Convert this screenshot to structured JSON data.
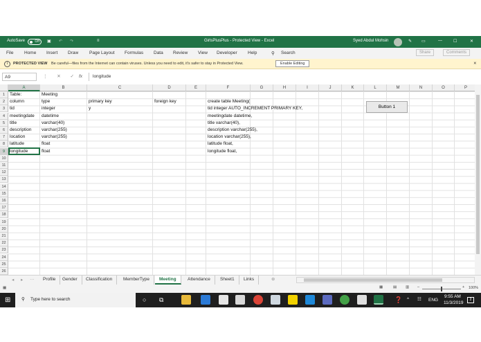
{
  "titlebar": {
    "autosave_label": "AutoSave",
    "autosave_state": "Off",
    "quick_access": [
      "↶",
      "↷",
      "≡"
    ],
    "doc_title": "GirlsPlusPlus - Protected View - Excel",
    "user_name": "Syed Abdul Mohsin",
    "window_controls": [
      "—",
      "☐",
      "✕"
    ]
  },
  "menu": {
    "items": [
      "File",
      "Home",
      "Insert",
      "Draw",
      "Page Layout",
      "Formulas",
      "Data",
      "Review",
      "View",
      "Developer",
      "Help"
    ],
    "search_label": "Search",
    "share_label": "Share",
    "comments_label": "Comments"
  },
  "protected_view": {
    "title": "PROTECTED VIEW",
    "message": "Be careful—files from the Internet can contain viruses. Unless you need to edit, it's safer to stay in Protected View.",
    "enable_label": "Enable Editing"
  },
  "formula_bar": {
    "name_box": "A9",
    "fx": "fx",
    "content": "longitude"
  },
  "columns": [
    "A",
    "B",
    "C",
    "D",
    "E",
    "F",
    "G",
    "H",
    "I",
    "J",
    "K",
    "L",
    "M",
    "N",
    "O",
    "P",
    "Q"
  ],
  "rows": [
    "1",
    "2",
    "3",
    "4",
    "5",
    "6",
    "7",
    "8",
    "9",
    "10",
    "11",
    "12",
    "13",
    "14",
    "15",
    "16",
    "17",
    "18",
    "19",
    "20",
    "21",
    "22",
    "23",
    "24",
    "25",
    "26"
  ],
  "cells": {
    "A1": "Table:",
    "B1": "Meeting",
    "A2": "column",
    "B2": "type",
    "C2": "primary key",
    "D2": "foreign key",
    "F2": "create table Meeting(",
    "A3": "tid",
    "B3": "integer",
    "C3": "y",
    "F3": "tid integer AUTO_INCREMENT PRIMARY KEY,",
    "A4": "meetingdate",
    "B4": "datetime",
    "F4": "meetingdate datetime,",
    "A5": "title",
    "B5": "varchar(40)",
    "F5": "title varchar(40),",
    "A6": "description",
    "B6": "varchar(255)",
    "F6": "description varchar(255),",
    "A7": "location",
    "B7": "varchar(255)",
    "F7": "location varchar(255),",
    "A8": "latitude",
    "B8": "float",
    "F8": "latitude float,",
    "A9": "longitude",
    "B9": "float",
    "F9": "longitude float,"
  },
  "button1_label": "Button 1",
  "sheets": {
    "tabs": [
      "Profile",
      "Gender",
      "Classification",
      "MemberType",
      "Meeting",
      "Attendance",
      "Sheet1",
      "Links"
    ],
    "active": "Meeting"
  },
  "status": {
    "zoom": "100%"
  },
  "taskbar": {
    "search_placeholder": "Type here to search",
    "time": "9:55 AM",
    "date": "11/3/2019",
    "lang": "ENG",
    "notifications": "2"
  },
  "colors": {
    "excel_green": "#217346",
    "warning_bar": "#fff4ce",
    "taskbar": "#1f1f1f"
  }
}
